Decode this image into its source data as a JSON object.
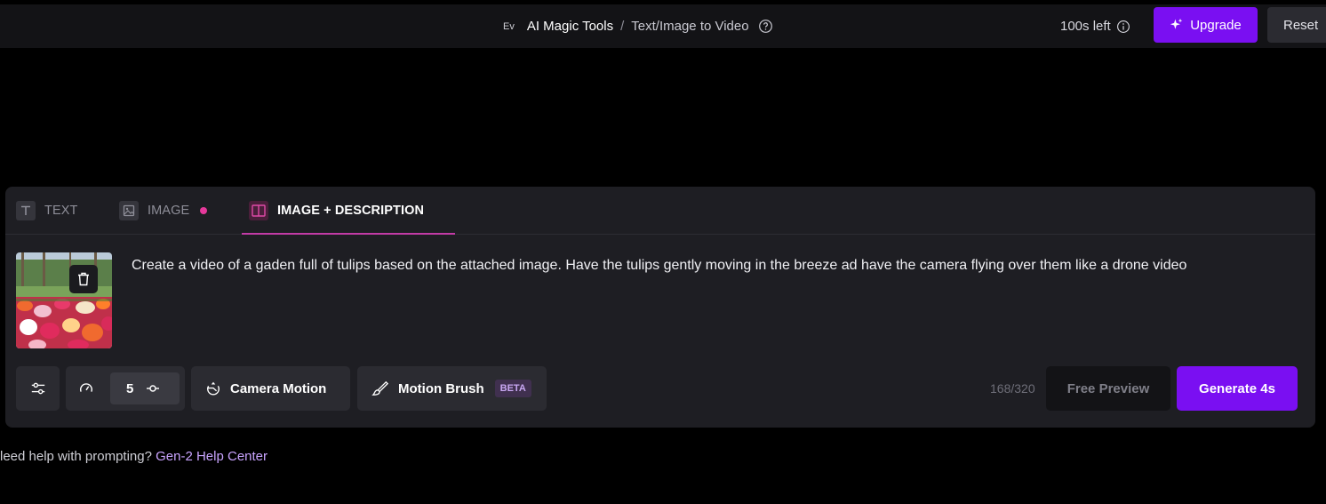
{
  "header": {
    "workspace_badge": "Ev",
    "breadcrumb_root": "AI Magic Tools",
    "breadcrumb_separator": "/",
    "breadcrumb_current": "Text/Image to Video",
    "credits_label": "100s left",
    "upgrade_label": "Upgrade",
    "reset_label": "Reset"
  },
  "tabs": [
    {
      "label": "TEXT",
      "icon": "text-icon",
      "active": false
    },
    {
      "label": "IMAGE",
      "icon": "image-icon",
      "active": false,
      "dot": true
    },
    {
      "label": "IMAGE + DESCRIPTION",
      "icon": "split-layout-icon",
      "active": true
    }
  ],
  "prompt": {
    "text": "Create a video of a gaden full of tulips based on the attached image. Have the tulips gently moving in the breeze ad have the camera flying over them like a drone video",
    "char_count": "168/320"
  },
  "toolbar": {
    "speed_value": "5",
    "camera_motion_label": "Camera Motion",
    "motion_brush_label": "Motion Brush",
    "beta_label": "BETA",
    "free_preview_label": "Free Preview",
    "generate_label": "Generate 4s"
  },
  "help": {
    "text": "leed help with prompting? ",
    "link": "Gen-2 Help Center"
  },
  "colors": {
    "accent": "#7a0ff2",
    "tab_underline": "#c23ba6",
    "dot": "#e6399b"
  }
}
